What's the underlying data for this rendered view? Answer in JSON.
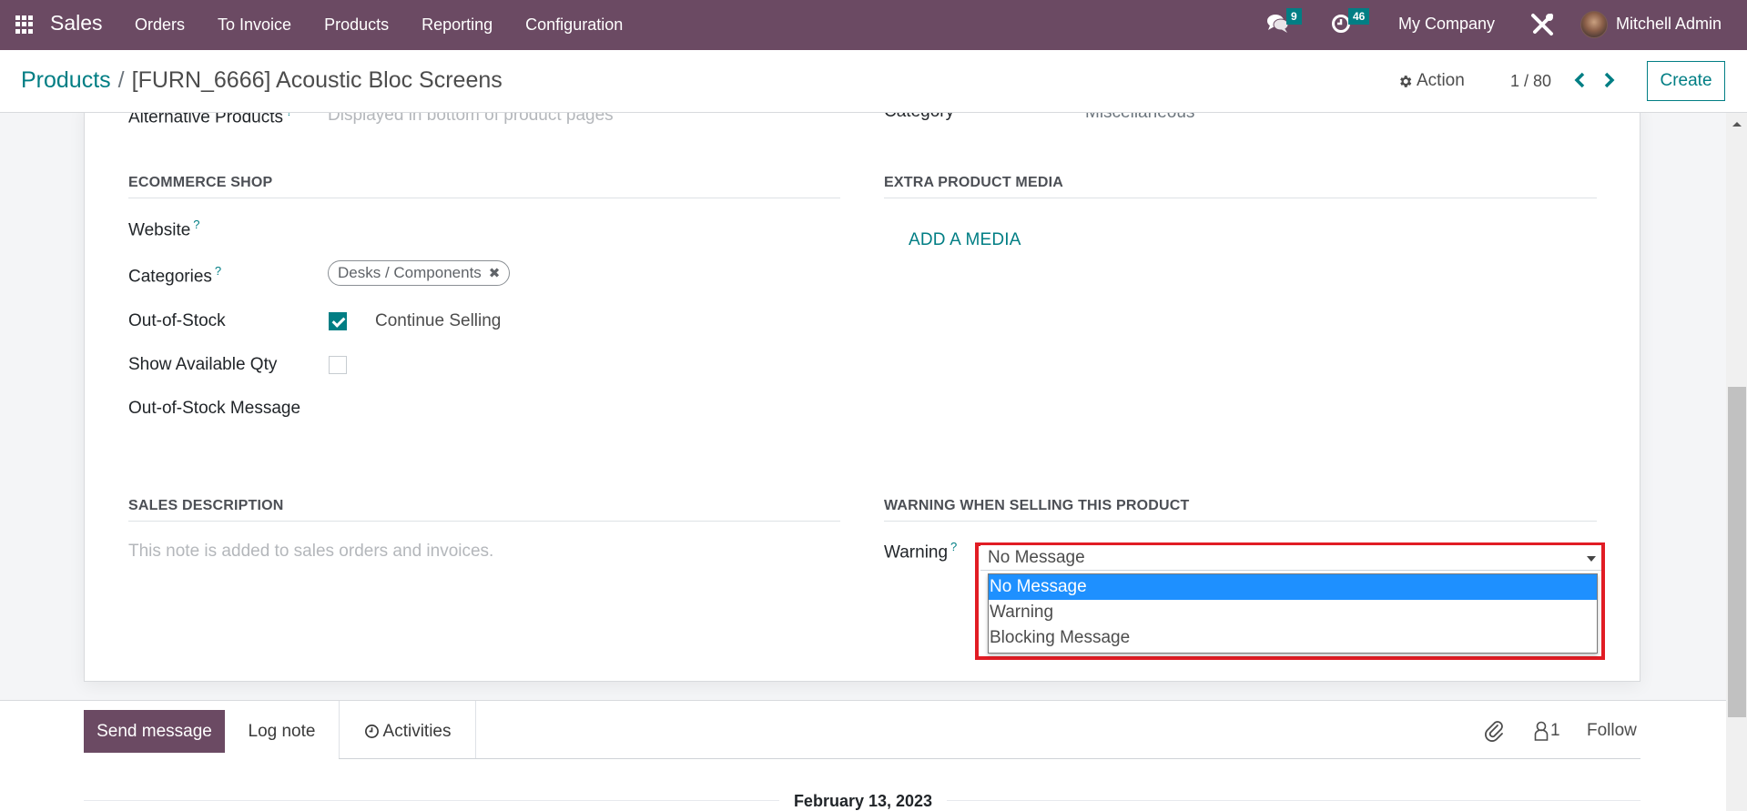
{
  "navbar": {
    "app_name": "Sales",
    "menu": [
      "Orders",
      "To Invoice",
      "Products",
      "Reporting",
      "Configuration"
    ],
    "messages_count": "9",
    "activities_count": "46",
    "company": "My Company",
    "user": "Mitchell Admin",
    "icons": {
      "apps": "apps-grid-icon",
      "messages": "chat-bubbles-icon",
      "activities": "clock-icon",
      "settings": "tools-icon"
    }
  },
  "control_panel": {
    "breadcrumb_parent": "Products",
    "breadcrumb_separator": "/",
    "breadcrumb_current": "[FURN_6666] Acoustic Bloc Screens",
    "action_label": "Action",
    "pager": "1 / 80",
    "create_label": "Create"
  },
  "form": {
    "partial_top": {
      "alternative_products_label": "Alternative Products",
      "alternative_products_placeholder": "Displayed in bottom of product pages",
      "category_label": "Category",
      "category_value": "Miscellaneous"
    },
    "ecommerce": {
      "title": "ECOMMERCE SHOP",
      "website_label": "Website",
      "categories_label": "Categories",
      "categories_tags": [
        "Desks / Components"
      ],
      "out_of_stock_label": "Out-of-Stock",
      "out_of_stock_checked": true,
      "out_of_stock_option": "Continue Selling",
      "show_qty_label": "Show Available Qty",
      "show_qty_checked": false,
      "oos_message_label": "Out-of-Stock Message"
    },
    "extra_media": {
      "title": "EXTRA PRODUCT MEDIA",
      "add_media_label": "ADD A MEDIA"
    },
    "sales_description": {
      "title": "SALES DESCRIPTION",
      "placeholder": "This note is added to sales orders and invoices."
    },
    "warning": {
      "title": "WARNING WHEN SELLING THIS PRODUCT",
      "label": "Warning",
      "selected": "No Message",
      "options": [
        "No Message",
        "Warning",
        "Blocking Message"
      ],
      "highlight_color": "#e11c24"
    },
    "help_marker": "?"
  },
  "chatter": {
    "send_message": "Send message",
    "log_note": "Log note",
    "activities": "Activities",
    "followers_count": "1",
    "follow": "Follow",
    "date_separator": "February 13, 2023"
  },
  "colors": {
    "brand": "#6b4a63",
    "accent": "#017e84",
    "option_highlight": "#1e90ff"
  }
}
